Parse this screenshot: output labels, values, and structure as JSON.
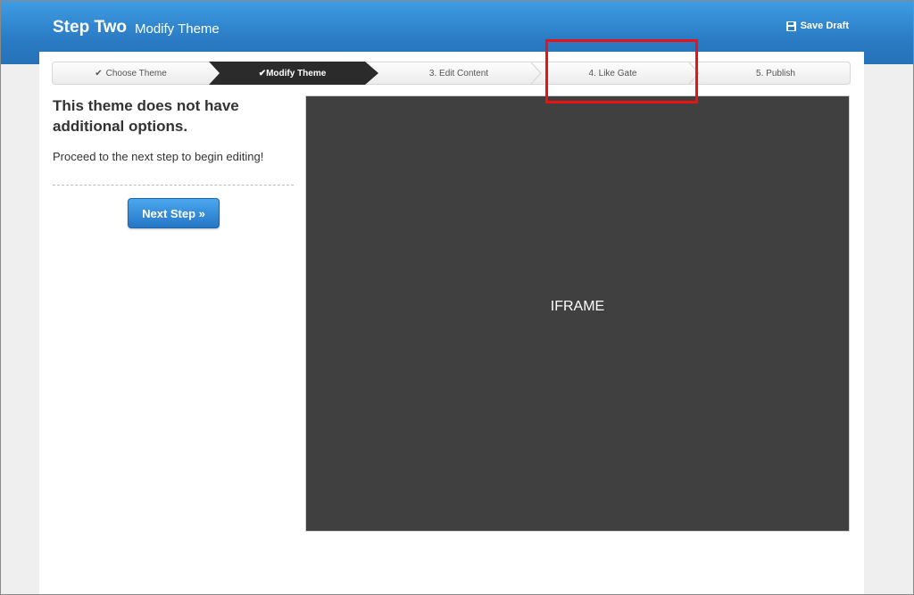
{
  "header": {
    "title": "Step Two",
    "subtitle": "Modify Theme",
    "save_draft_label": "Save Draft",
    "save_icon": "floppy-disk-icon",
    "color": "#2a7cc4"
  },
  "steps": [
    {
      "label": "Choose Theme",
      "state": "completed"
    },
    {
      "label": "Modify Theme",
      "state": "active"
    },
    {
      "label": "3. Edit Content",
      "state": "upcoming"
    },
    {
      "label": "4. Like Gate",
      "state": "upcoming",
      "highlighted": true
    },
    {
      "label": "5. Publish",
      "state": "upcoming"
    }
  ],
  "left_panel": {
    "heading": "This theme does not have additional options.",
    "text": "Proceed to the next step to begin editing!",
    "next_button": "Next Step »"
  },
  "preview": {
    "label": "IFRAME"
  },
  "highlight_color": "#e11111"
}
